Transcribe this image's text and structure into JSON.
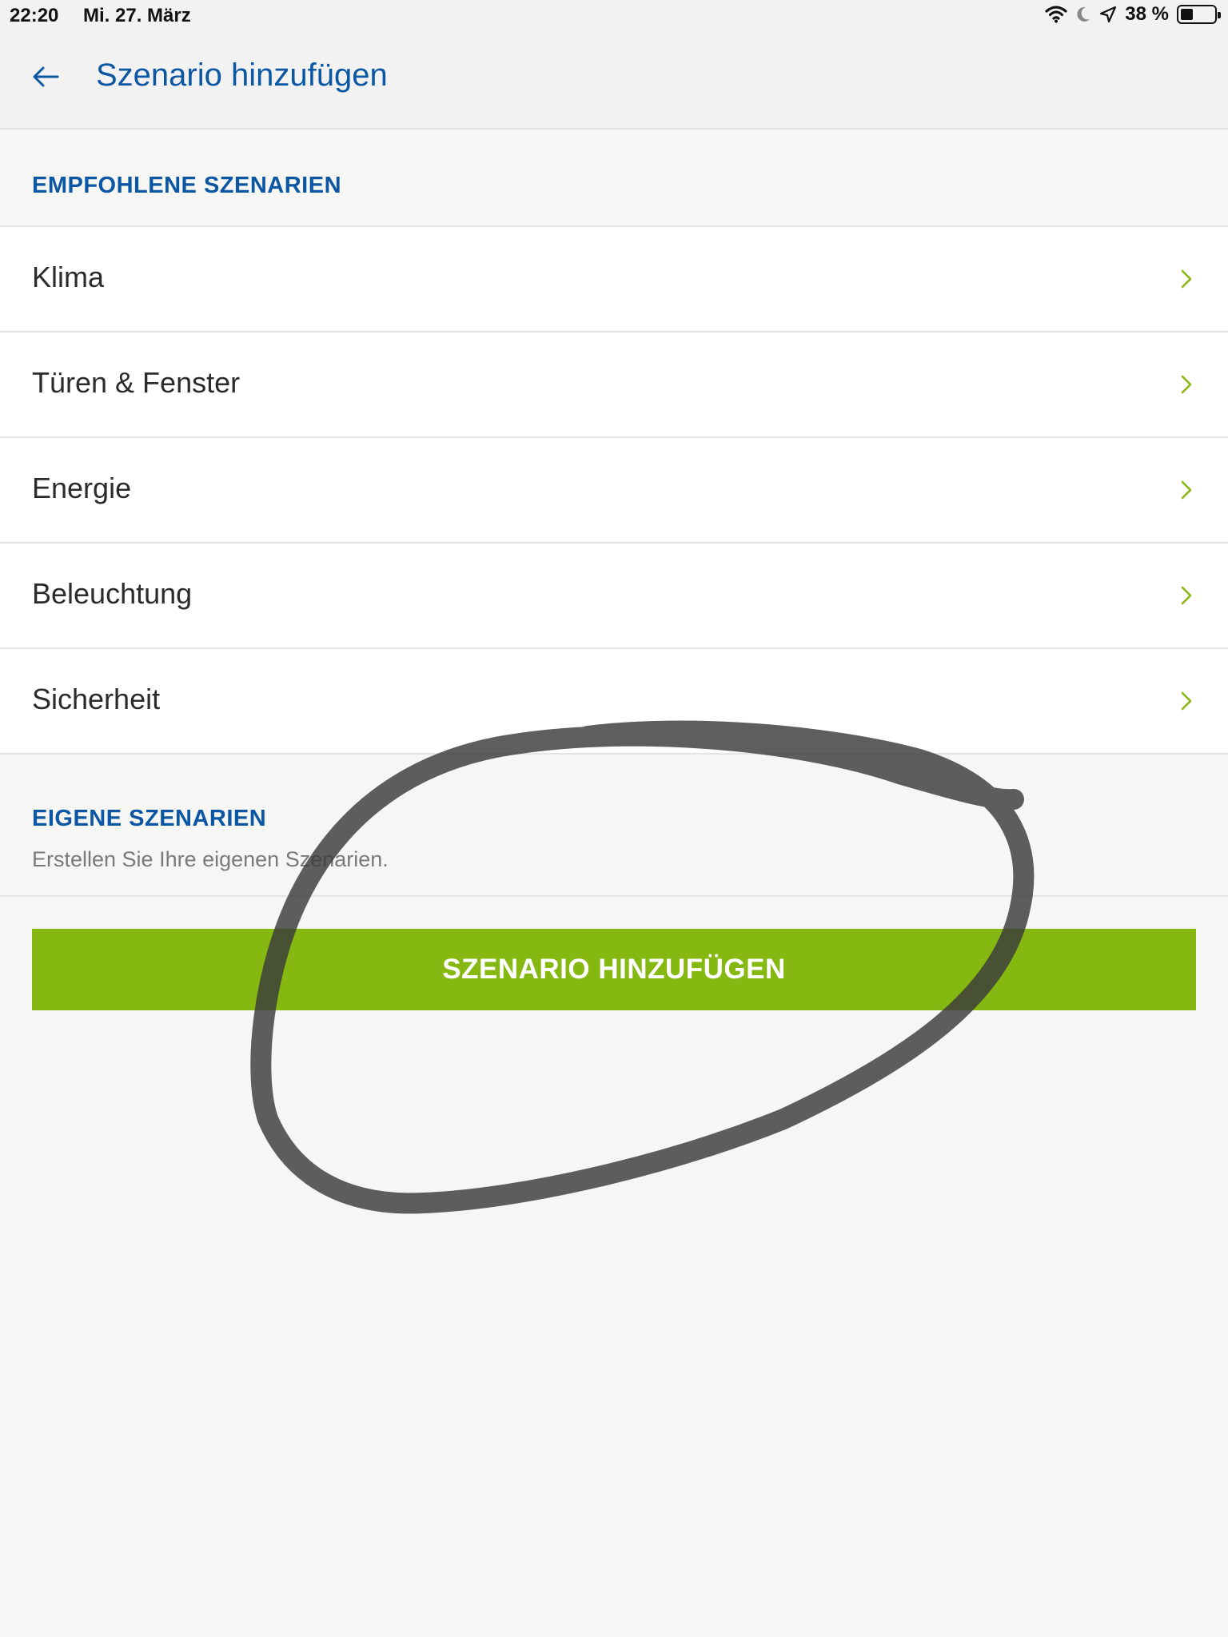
{
  "status_bar": {
    "time": "22:20",
    "date": "Mi. 27. März",
    "battery_percent": "38 %",
    "battery_level": 0.38,
    "icons": [
      "wifi-icon",
      "moon-icon",
      "location-arrow-icon",
      "battery-icon"
    ]
  },
  "nav": {
    "back_icon": "arrow-left-icon",
    "title": "Szenario hinzufügen"
  },
  "recommended": {
    "title": "EMPFOHLENE SZENARIEN",
    "items": [
      {
        "label": "Klima"
      },
      {
        "label": "Türen & Fenster"
      },
      {
        "label": "Energie"
      },
      {
        "label": "Beleuchtung"
      },
      {
        "label": "Sicherheit"
      }
    ]
  },
  "own": {
    "title": "EIGENE SZENARIEN",
    "subtitle": "Erstellen Sie Ihre eigenen Szenarien.",
    "button_label": "SZENARIO HINZUFÜGEN"
  },
  "colors": {
    "brand_blue": "#0b57a4",
    "accent_green": "#86b812",
    "background": "#f6f6f5",
    "annotation": "#3a3a3a"
  },
  "annotation": {
    "type": "hand-drawn-circle",
    "target": "add-scenario-button"
  }
}
